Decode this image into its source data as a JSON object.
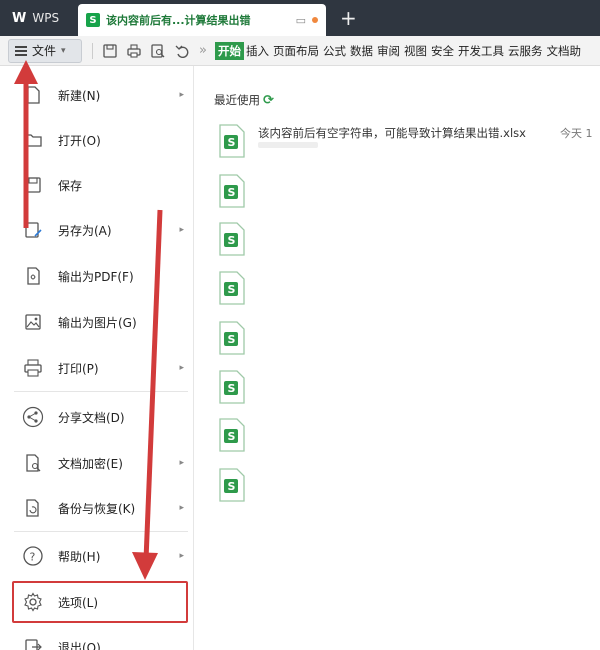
{
  "app": {
    "name": "WPS",
    "doc_tab_title": "该内容前后有...计算结果出错",
    "doc_badge": "S",
    "new_tab": "+"
  },
  "toolbar": {
    "file_label": "文件",
    "ribbon_tabs": [
      "开始",
      "插入",
      "页面布局",
      "公式",
      "数据",
      "审阅",
      "视图",
      "安全",
      "开发工具",
      "云服务",
      "文档助"
    ]
  },
  "menu": {
    "items": [
      {
        "label": "新建(N)",
        "icon": "new-doc-icon",
        "has_arrow": true
      },
      {
        "label": "打开(O)",
        "icon": "folder-icon",
        "has_arrow": false
      },
      {
        "label": "保存",
        "icon": "save-icon",
        "has_arrow": false
      },
      {
        "label": "另存为(A)",
        "icon": "save-as-icon",
        "has_arrow": true
      },
      {
        "label": "输出为PDF(F)",
        "icon": "pdf-export-icon",
        "has_arrow": false
      },
      {
        "label": "输出为图片(G)",
        "icon": "image-export-icon",
        "has_arrow": false
      },
      {
        "label": "打印(P)",
        "icon": "printer-icon",
        "has_arrow": true
      },
      {
        "label": "分享文档(D)",
        "icon": "share-icon",
        "has_arrow": false
      },
      {
        "label": "文档加密(E)",
        "icon": "encrypt-icon",
        "has_arrow": true
      },
      {
        "label": "备份与恢复(K)",
        "icon": "backup-icon",
        "has_arrow": true
      },
      {
        "label": "帮助(H)",
        "icon": "help-icon",
        "has_arrow": true
      },
      {
        "label": "选项(L)",
        "icon": "gear-icon",
        "has_arrow": false
      },
      {
        "label": "退出(Q)",
        "icon": "exit-icon",
        "has_arrow": false
      }
    ]
  },
  "recent": {
    "title": "最近使用",
    "files": [
      {
        "name": "该内容前后有空字符串，可能导致计算结果出错.xlsx",
        "time": "今天 1"
      },
      {
        "name": "",
        "time": ""
      },
      {
        "name": "",
        "time": ""
      },
      {
        "name": "",
        "time": ""
      },
      {
        "name": "",
        "time": ""
      },
      {
        "name": "",
        "time": ""
      },
      {
        "name": "",
        "time": ""
      },
      {
        "name": "",
        "time": ""
      }
    ]
  },
  "colors": {
    "accent_green": "#2e9a4b",
    "annotation_red": "#d23b3b",
    "titlebar": "#2f3640"
  }
}
